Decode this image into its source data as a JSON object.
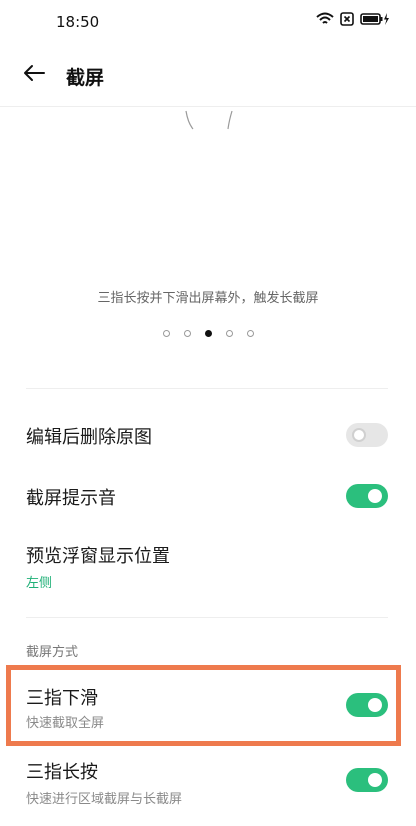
{
  "status_bar": {
    "time": "18:50"
  },
  "header": {
    "title": "截屏"
  },
  "tutorial": {
    "caption": "三指长按并下滑出屏幕外，触发长截屏",
    "page_count": 5,
    "active_page": 3
  },
  "settings": [
    {
      "title": "编辑后删除原图",
      "toggle": false
    },
    {
      "title": "截屏提示音",
      "toggle": true
    },
    {
      "title": "预览浮窗显示位置",
      "value": "左侧"
    }
  ],
  "section": {
    "header": "截屏方式"
  },
  "methods": [
    {
      "title": "三指下滑",
      "subtitle": "快速截取全屏",
      "toggle": true
    },
    {
      "title": "三指长按",
      "subtitle": "快速进行区域截屏与长截屏",
      "toggle": true
    }
  ],
  "colors": {
    "accent": "#2bbf7d",
    "highlight": "#ee7a4d",
    "value_text": "#1fb077"
  }
}
